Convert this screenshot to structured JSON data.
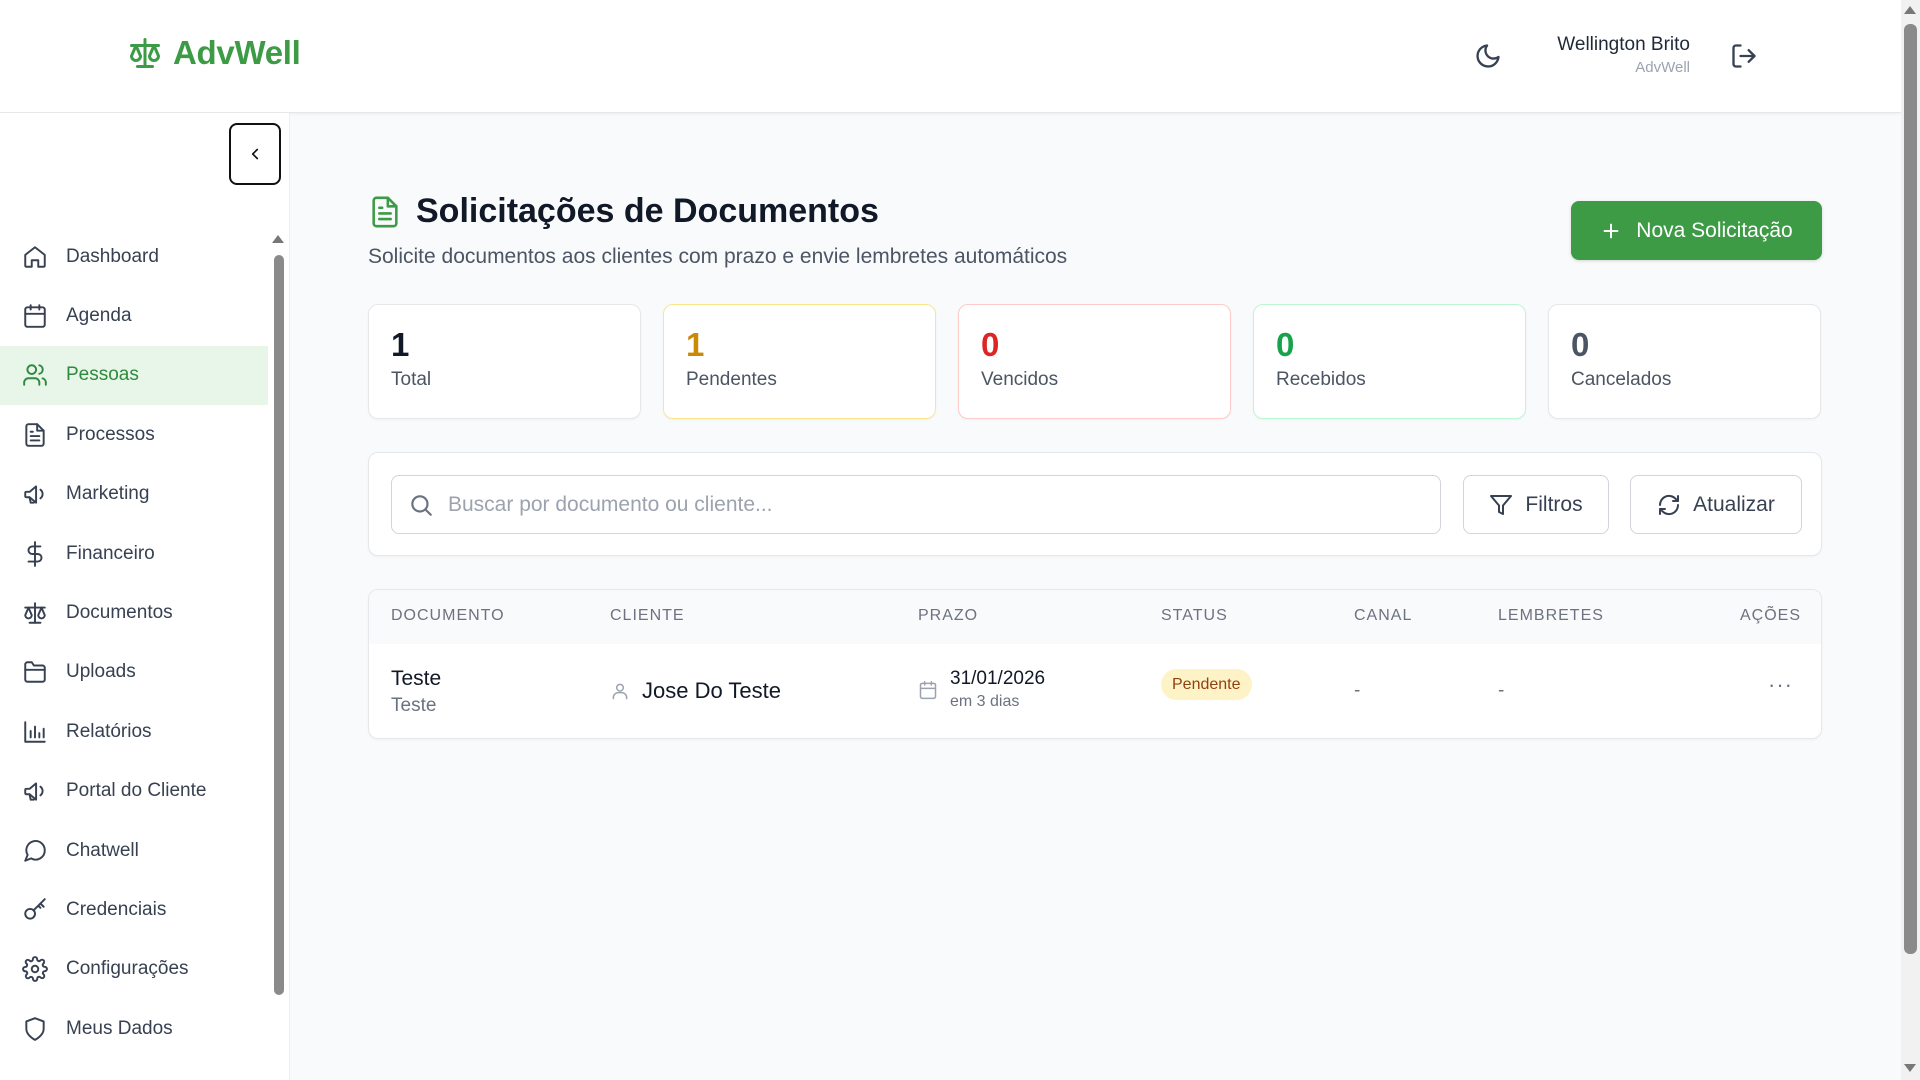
{
  "app": {
    "name": "AdvWell",
    "brand_color": "#3d9b46"
  },
  "header": {
    "user_name": "Wellington Brito",
    "user_org": "AdvWell",
    "theme_icon": "moon-icon",
    "logout_icon": "logout-icon"
  },
  "sidebar": {
    "items": [
      {
        "label": "Dashboard",
        "icon": "home-icon",
        "active": false
      },
      {
        "label": "Agenda",
        "icon": "calendar-icon",
        "active": false
      },
      {
        "label": "Pessoas",
        "icon": "users-icon",
        "active": true
      },
      {
        "label": "Processos",
        "icon": "file-text-icon",
        "active": false
      },
      {
        "label": "Marketing",
        "icon": "megaphone-icon",
        "active": false
      },
      {
        "label": "Financeiro",
        "icon": "dollar-icon",
        "active": false
      },
      {
        "label": "Documentos",
        "icon": "scale-icon",
        "active": false
      },
      {
        "label": "Uploads",
        "icon": "folder-icon",
        "active": false
      },
      {
        "label": "Relatórios",
        "icon": "bar-chart-icon",
        "active": false
      },
      {
        "label": "Portal do Cliente",
        "icon": "megaphone-icon",
        "active": false
      },
      {
        "label": "Chatwell",
        "icon": "message-circle-icon",
        "active": false
      },
      {
        "label": "Credenciais",
        "icon": "key-icon",
        "active": false
      },
      {
        "label": "Configurações",
        "icon": "gear-icon",
        "active": false
      },
      {
        "label": "Meus Dados",
        "icon": "shield-icon",
        "active": false
      }
    ]
  },
  "main": {
    "title": "Solicitações de Documentos",
    "subtitle": "Solicite documentos aos clientes com prazo e envie lembretes automáticos",
    "new_button": "Nova Solicitação",
    "stats": [
      {
        "value": "1",
        "label": "Total",
        "color": "#111827",
        "border": "#e5e7eb"
      },
      {
        "value": "1",
        "label": "Pendentes",
        "color": "#ca8a04",
        "border": "#fde68a"
      },
      {
        "value": "0",
        "label": "Vencidos",
        "color": "#dc2626",
        "border": "#fecaca"
      },
      {
        "value": "0",
        "label": "Recebidos",
        "color": "#16a34a",
        "border": "#bbf7d0"
      },
      {
        "value": "0",
        "label": "Cancelados",
        "color": "#4b5563",
        "border": "#e5e7eb"
      }
    ],
    "search_placeholder": "Buscar por documento ou cliente...",
    "filter_button": "Filtros",
    "refresh_button": "Atualizar",
    "table": {
      "headers": [
        "DOCUMENTO",
        "CLIENTE",
        "PRAZO",
        "STATUS",
        "CANAL",
        "LEMBRETES",
        "AÇÕES"
      ],
      "rows": [
        {
          "documento": "Teste",
          "documento_sub": "Teste",
          "cliente": "Jose Do Teste",
          "prazo": "31/01/2026",
          "prazo_rel": "em 3 dias",
          "status": "Pendente",
          "canal": "-",
          "lembretes": "-",
          "acoes": "···"
        }
      ]
    }
  }
}
